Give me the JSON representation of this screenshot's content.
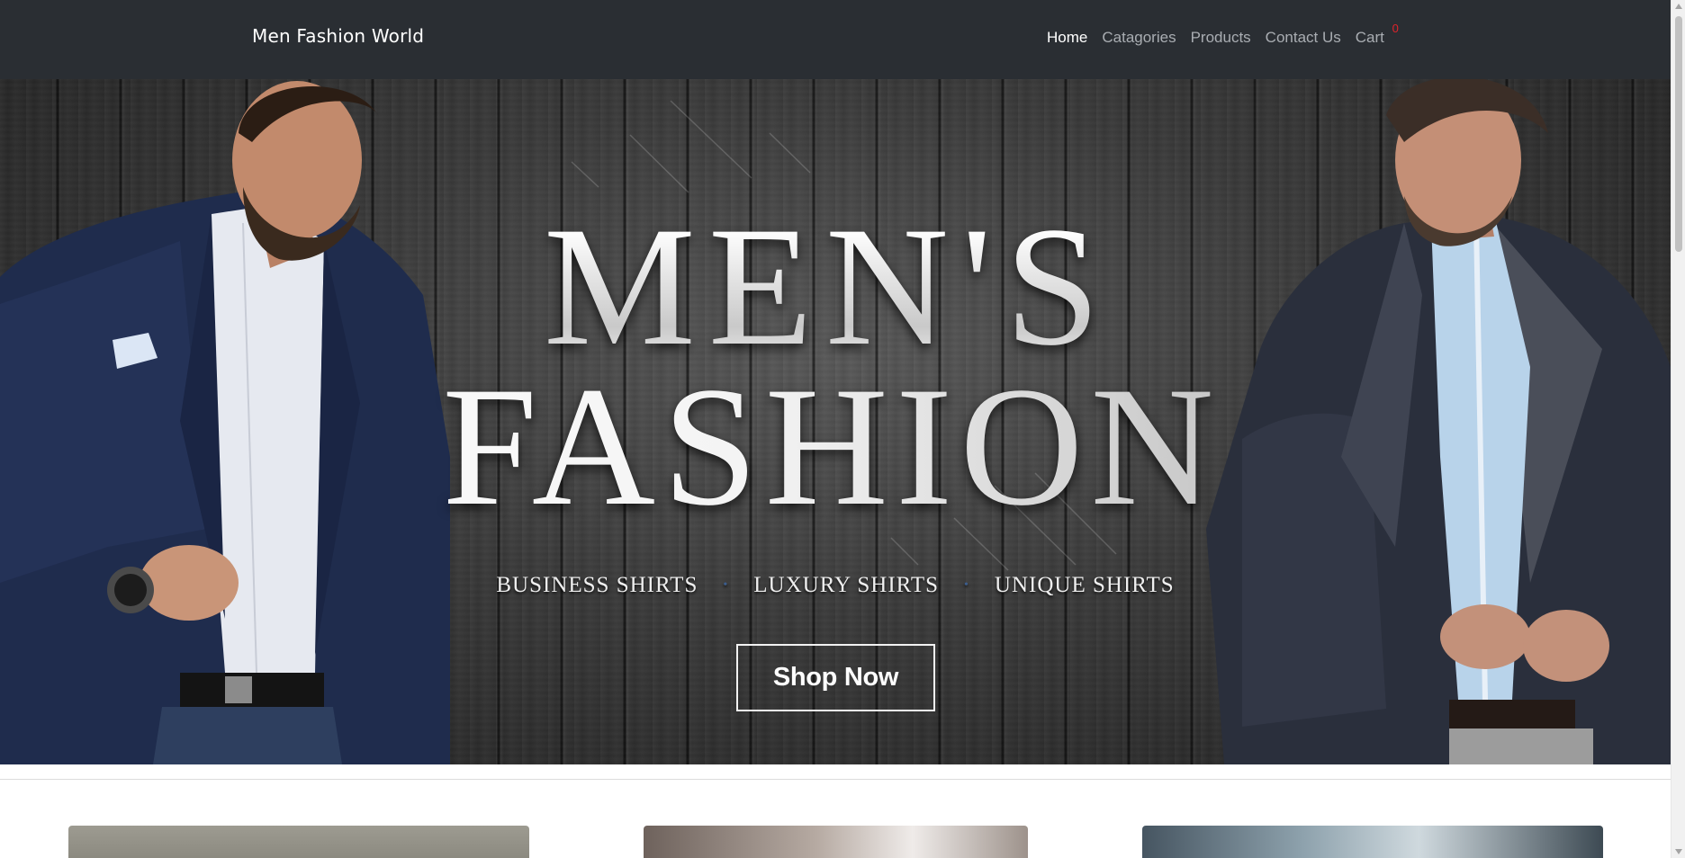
{
  "navbar": {
    "brand": "Men Fashion World",
    "links": [
      {
        "label": "Home",
        "active": true
      },
      {
        "label": "Catagories",
        "active": false
      },
      {
        "label": "Products",
        "active": false
      },
      {
        "label": "Contact Us",
        "active": false
      }
    ],
    "cart": {
      "label": "Cart",
      "count": "0"
    }
  },
  "hero": {
    "title_line1": "MEN'S",
    "title_line2": "FASHION",
    "taglines": [
      "BUSINESS SHIRTS",
      "LUXURY SHIRTS",
      "UNIQUE SHIRTS"
    ],
    "separator": "•",
    "cta": "Shop Now"
  },
  "colors": {
    "navbar_bg": "#2a2e33",
    "nav_active": "#ffffff",
    "nav_inactive": "#a9adb2",
    "cart_badge": "#e0232b",
    "tagline_dot": "#3c5d8c"
  },
  "icons": {
    "scroll_up": "chevron-up-icon",
    "scroll_down": "chevron-down-icon"
  }
}
